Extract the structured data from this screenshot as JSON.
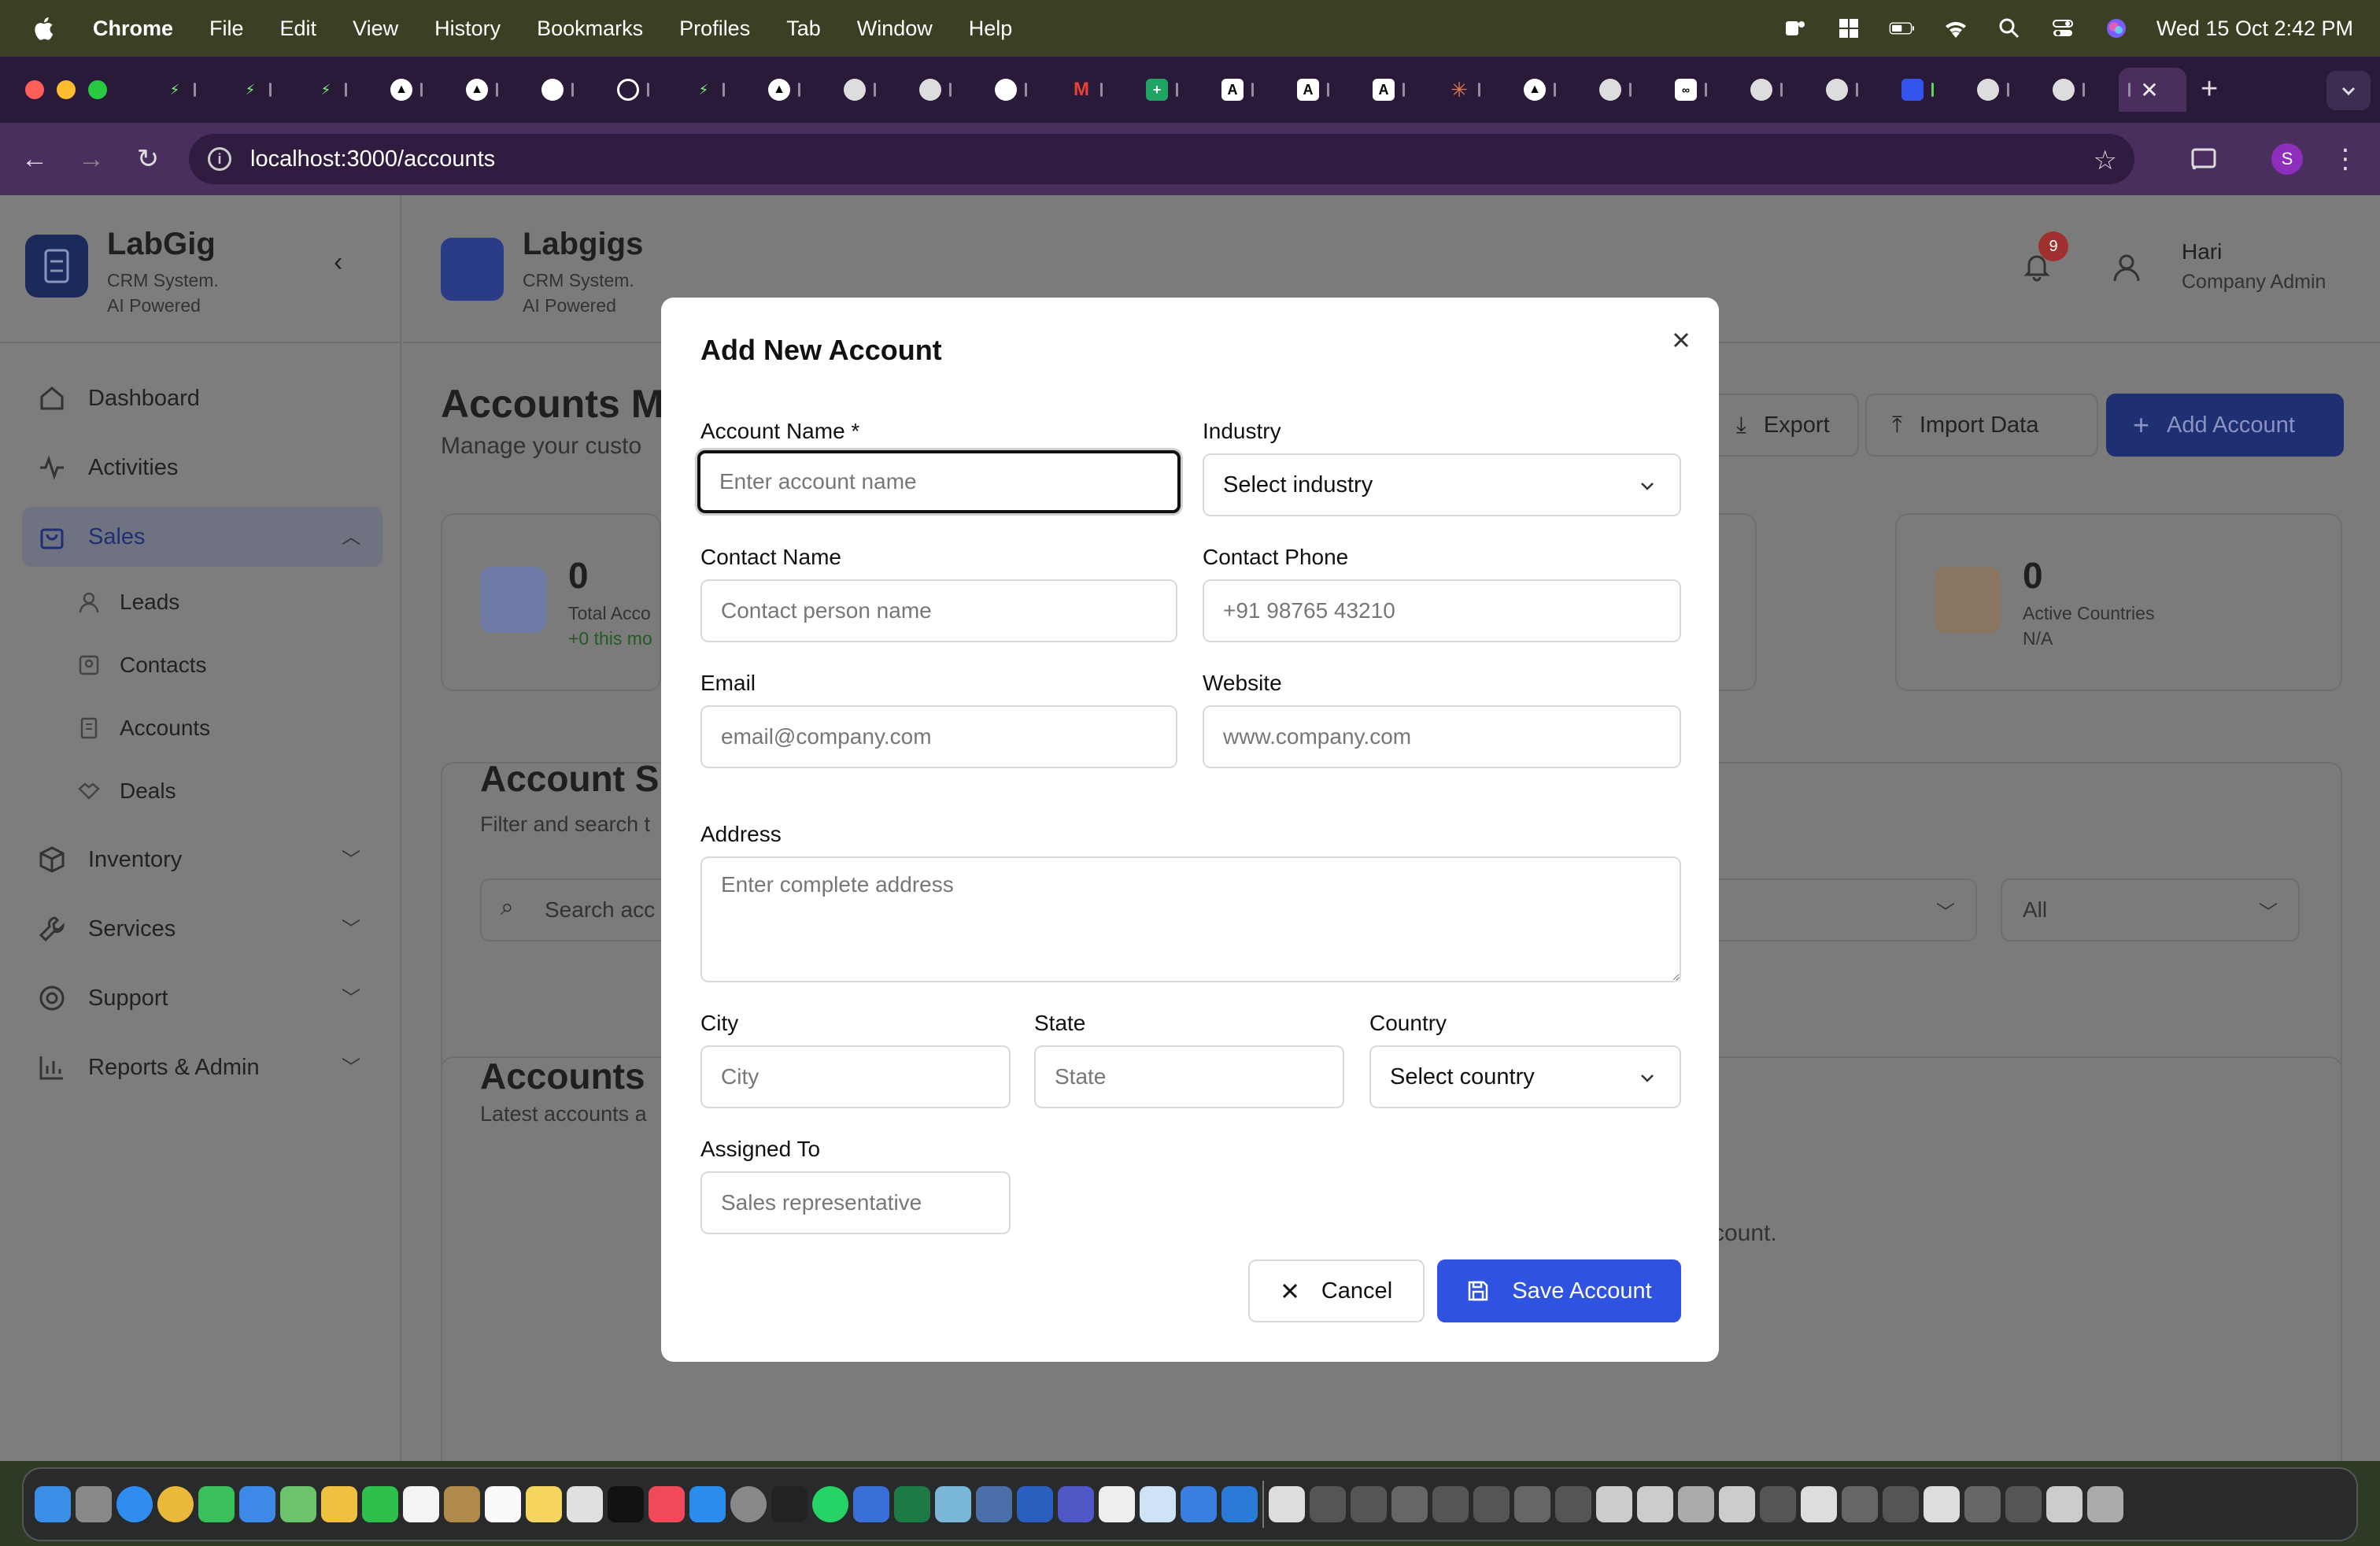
{
  "menubar": {
    "app_name": "Chrome",
    "items": [
      "File",
      "Edit",
      "View",
      "History",
      "Bookmarks",
      "Profiles",
      "Tab",
      "Window",
      "Help"
    ],
    "clock": "Wed 15 Oct  2:42 PM"
  },
  "browser": {
    "url": "localhost:3000/accounts",
    "profile_initial": "S"
  },
  "sidebar": {
    "brand_title": "LabGig",
    "brand_sub1": "CRM System.",
    "brand_sub2": "AI Powered",
    "nav": [
      {
        "label": "Dashboard"
      },
      {
        "label": "Activities"
      },
      {
        "label": "Sales"
      },
      {
        "label": "Inventory"
      },
      {
        "label": "Services"
      },
      {
        "label": "Support"
      },
      {
        "label": "Reports & Admin"
      }
    ],
    "sales_sub": [
      {
        "label": "Leads"
      },
      {
        "label": "Contacts"
      },
      {
        "label": "Accounts"
      },
      {
        "label": "Deals"
      }
    ]
  },
  "header": {
    "org_title": "Labgigs",
    "org_sub1": "CRM System.",
    "org_sub2": "AI Powered",
    "notifications": "9",
    "user_name": "Hari",
    "user_role": "Company Admin"
  },
  "main": {
    "page_title": "Accounts M",
    "page_sub": "Manage your custo",
    "export_label": "Export",
    "import_label": "Import Data",
    "add_label": "Add Account",
    "stat1_value": "0",
    "stat1_label": "Total Acco",
    "stat1_extra": "+0 this mo",
    "stat2_value": "0",
    "stat2_label": "Active Countries",
    "stat2_extra": "N/A",
    "search_title": "Account S",
    "search_sub": "Filter and search t",
    "search_placeholder": "Search acc",
    "filter_all": "All",
    "recent_title": "Accounts",
    "recent_sub": "Latest accounts a",
    "empty_text": "count."
  },
  "modal": {
    "title": "Add New Account",
    "account_name_label": "Account Name *",
    "account_name_placeholder": "Enter account name",
    "industry_label": "Industry",
    "industry_value": "Select industry",
    "contact_name_label": "Contact Name",
    "contact_name_placeholder": "Contact person name",
    "contact_phone_label": "Contact Phone",
    "contact_phone_placeholder": "+91 98765 43210",
    "email_label": "Email",
    "email_placeholder": "email@company.com",
    "website_label": "Website",
    "website_placeholder": "www.company.com",
    "address_label": "Address",
    "address_placeholder": "Enter complete address",
    "city_label": "City",
    "city_placeholder": "City",
    "state_label": "State",
    "state_placeholder": "State",
    "country_label": "Country",
    "country_value": "Select country",
    "assigned_label": "Assigned To",
    "assigned_placeholder": "Sales representative",
    "cancel_label": "Cancel",
    "save_label": "Save Account"
  },
  "colors": {
    "primary": "#2f53e0",
    "menubar": "#3b3f24",
    "tabstrip": "#2a1a3a",
    "toolbar": "#4a2f5e"
  }
}
